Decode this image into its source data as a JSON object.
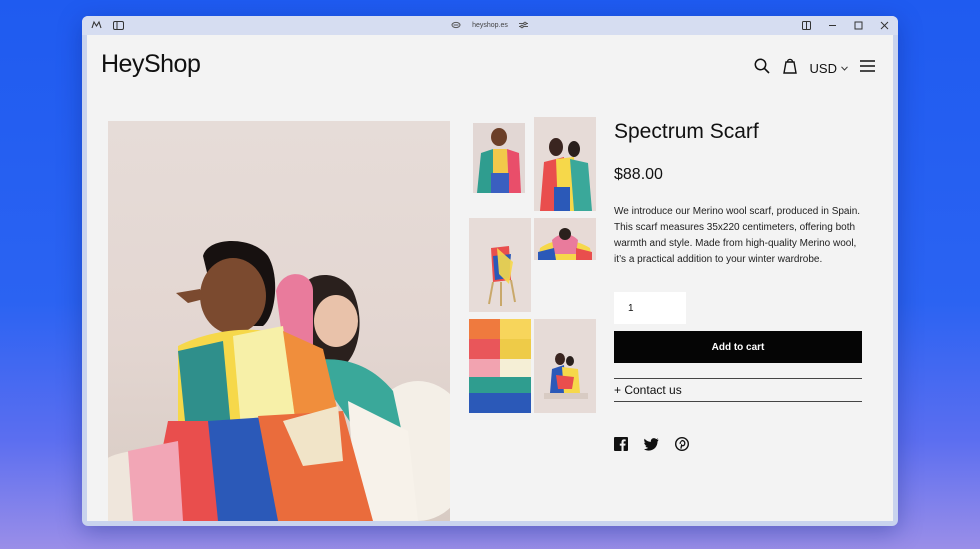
{
  "browser": {
    "url": "heyshop.es"
  },
  "header": {
    "logo": "HeyShop",
    "currency": "USD"
  },
  "product": {
    "title": "Spectrum Scarf",
    "price": "$88.00",
    "description": "We introduce our Merino wool scarf, produced in Spain. This scarf measures 35x220 centimeters, offering both warmth and style. Made from high-quality Merino wool, it’s a practical addition to your winter wardrobe.",
    "quantity": "1",
    "add_to_cart_label": "Add to cart",
    "contact_label": "+ Contact us"
  },
  "icons": {
    "search": "search-icon",
    "cart": "shopping-bag-icon",
    "menu": "hamburger-menu-icon",
    "social": [
      "facebook-icon",
      "twitter-icon",
      "pinterest-icon"
    ]
  },
  "colors": {
    "desktop": "#2b63f2",
    "page_bg": "#f3f3f3",
    "button_bg": "#050505",
    "button_text": "#ffffff"
  }
}
